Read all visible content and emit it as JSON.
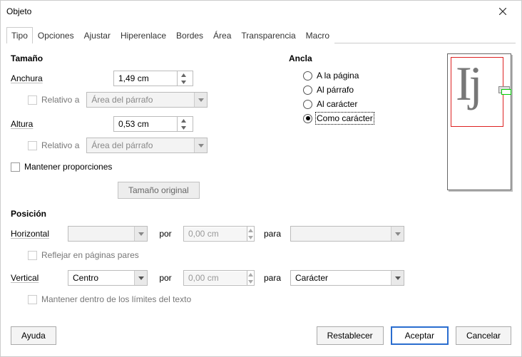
{
  "title": "Objeto",
  "tabs": [
    "Tipo",
    "Opciones",
    "Ajustar",
    "Hiperenlace",
    "Bordes",
    "Área",
    "Transparencia",
    "Macro"
  ],
  "size": {
    "heading": "Tamaño",
    "width_label": "Anchura",
    "width_value": "1,49 cm",
    "relto_label": "Relativo a",
    "relto_value": "Área del párrafo",
    "height_label": "Altura",
    "height_value": "0,53 cm",
    "keep_label": "Mantener proporciones",
    "orig_btn": "Tamaño original"
  },
  "anchor": {
    "heading": "Ancla",
    "options": [
      "A la página",
      "Al párrafo",
      "Al carácter",
      "Como carácter"
    ],
    "selected": 3
  },
  "position": {
    "heading": "Posición",
    "h_label": "Horizontal",
    "v_label": "Vertical",
    "by": "por",
    "to": "para",
    "h_sel": "",
    "h_val": "0,00 cm",
    "h_to": "",
    "v_sel": "Centro",
    "v_val": "0,00 cm",
    "v_to": "Carácter",
    "mirror": "Reflejar en páginas pares",
    "flow": "Mantener dentro de los límites del texto"
  },
  "buttons": {
    "help": "Ayuda",
    "reset": "Restablecer",
    "ok": "Aceptar",
    "cancel": "Cancelar"
  }
}
